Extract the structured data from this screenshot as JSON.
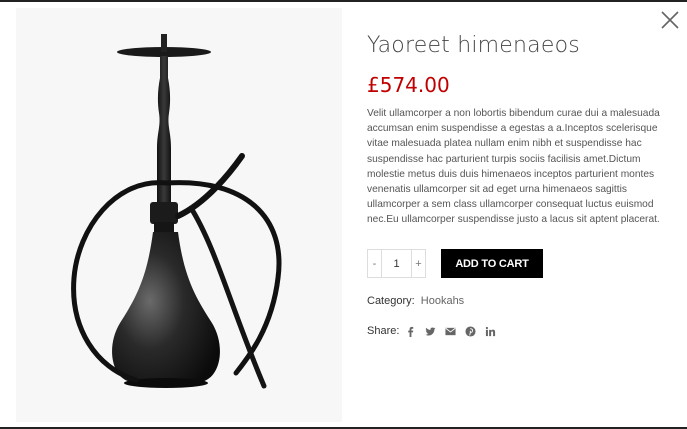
{
  "product": {
    "title": "Yaoreet himenaeos",
    "price": "£574.00",
    "description": "Velit ullamcorper a non lobortis bibendum curae dui a malesuada accumsan enim suspendisse a egestas a a.Inceptos scelerisque vitae malesuada platea nullam enim nibh et suspendisse hac suspendisse hac parturient turpis sociis facilisis amet.Dictum molestie metus duis duis himenaeos inceptos parturient montes venenatis ullamcorper sit ad eget urna himenaeos sagittis ullamcorper a sem class ullamcorper consequat luctus euismod nec.Eu ullamcorper suspendisse justo a lacus sit aptent placerat.",
    "image_icon": "hookah-image"
  },
  "quantity": {
    "minus": "-",
    "value": "1",
    "plus": "+"
  },
  "cart": {
    "add_label": "ADD TO CART"
  },
  "meta": {
    "category_label": "Category:",
    "category_value": "Hookahs",
    "share_label": "Share:"
  },
  "share_icons": [
    "facebook-icon",
    "twitter-icon",
    "email-icon",
    "pinterest-icon",
    "linkedin-icon"
  ],
  "colors": {
    "price": "#c00000",
    "button_bg": "#000000",
    "button_text": "#ffffff"
  }
}
